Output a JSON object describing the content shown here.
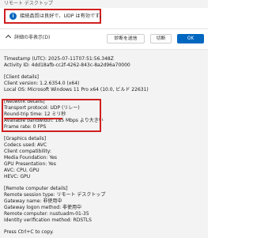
{
  "window": {
    "title": "リモート デスクトップ"
  },
  "status": {
    "icon": "info-icon",
    "message": "接続品質は良好で、UDP は有効です。"
  },
  "toggle": {
    "label": "詳細の非表示(D)"
  },
  "buttons": {
    "send": "診断を送信",
    "copy": "切断",
    "ok": "OK"
  },
  "details": {
    "timestamp": "Timestamp (UTC): 2025-07-11T07:51:56.348Z",
    "activity_id": "Activity ID: 4dd18afb-cc2f-4262-843c-8a2d96a70000",
    "client_header": "[Client details]",
    "client_version": "Client version: 1.2.6354.0 (x64)",
    "local_os": "Local OS: Microsoft Windows 11 Pro x64 (10.0, ビルド 22631)",
    "network_header": "[Network details]",
    "transport": "Transport protocol: UDP (リレー)",
    "rtt": "Round-trip time: 12 ミリ秒",
    "bandwidth": "Available bandwidth: 185 Mbps より大きい",
    "frame_rate": "Frame rate: 0 FPS",
    "graphics_header": "[Graphics details]",
    "codecs": "Codecs used: AVC",
    "compat": "Client compatibility:",
    "media": "Media Foundation: Yes",
    "gpu_pres": "GPU Presentation: Yes",
    "avc": "AVC: CPU, GPU",
    "hevc": "HEVC: GPU",
    "remote_header": "[Remote computer details]",
    "session_type": "Remote session type: リモート デスクトップ",
    "gateway_name": "Gateway name: 非使用中",
    "gateway_logon": "Gateway logon method: 非使用中",
    "remote_computer": "Remote computer: nustuadm-01-35",
    "identity": "Identity verification method: RDSTLS",
    "footer": "Press Ctrl+C to copy."
  }
}
